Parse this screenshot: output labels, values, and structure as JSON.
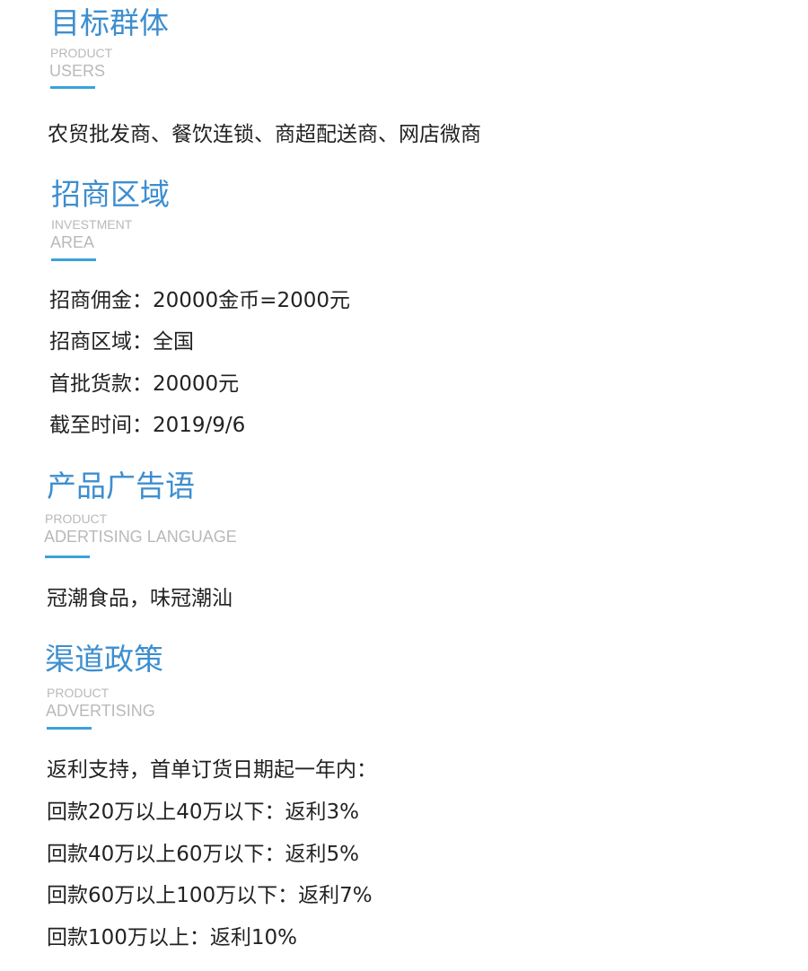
{
  "sections": {
    "target_users": {
      "title": "目标群体",
      "en_line1": "PRODUCT",
      "en_line2": "USERS",
      "text": "农贸批发商、餐饮连锁、商超配送商、网店微商"
    },
    "investment_area": {
      "title": "招商区域",
      "en_line1": "INVESTMENT",
      "en_line2": "AREA",
      "lines": [
        "招商佣金：20000金币=2000元",
        "招商区域：全国",
        "首批货款：20000元",
        "截至时间：2019/9/6"
      ]
    },
    "ad_slogan": {
      "title": "产品广告语",
      "en_line1": "PRODUCT",
      "en_line2": "ADERTISING LANGUAGE",
      "text": "冠潮食品，味冠潮汕"
    },
    "channel_policy": {
      "title": "渠道政策",
      "en_line1": "PRODUCT",
      "en_line2": "ADVERTISING",
      "lines": [
        "返利支持，首单订货日期起一年内：",
        "回款20万以上40万以下：返利3%",
        "回款40万以上60万以下：返利5%",
        "回款60万以上100万以下：返利7%",
        "回款100万以上：返利10%"
      ]
    }
  },
  "colors": {
    "title": "#3d8ecf",
    "accent_bar": "#3aa2dc",
    "subtitle_en": "#b9b9b9",
    "body_text": "#222222",
    "background": "#ffffff"
  }
}
